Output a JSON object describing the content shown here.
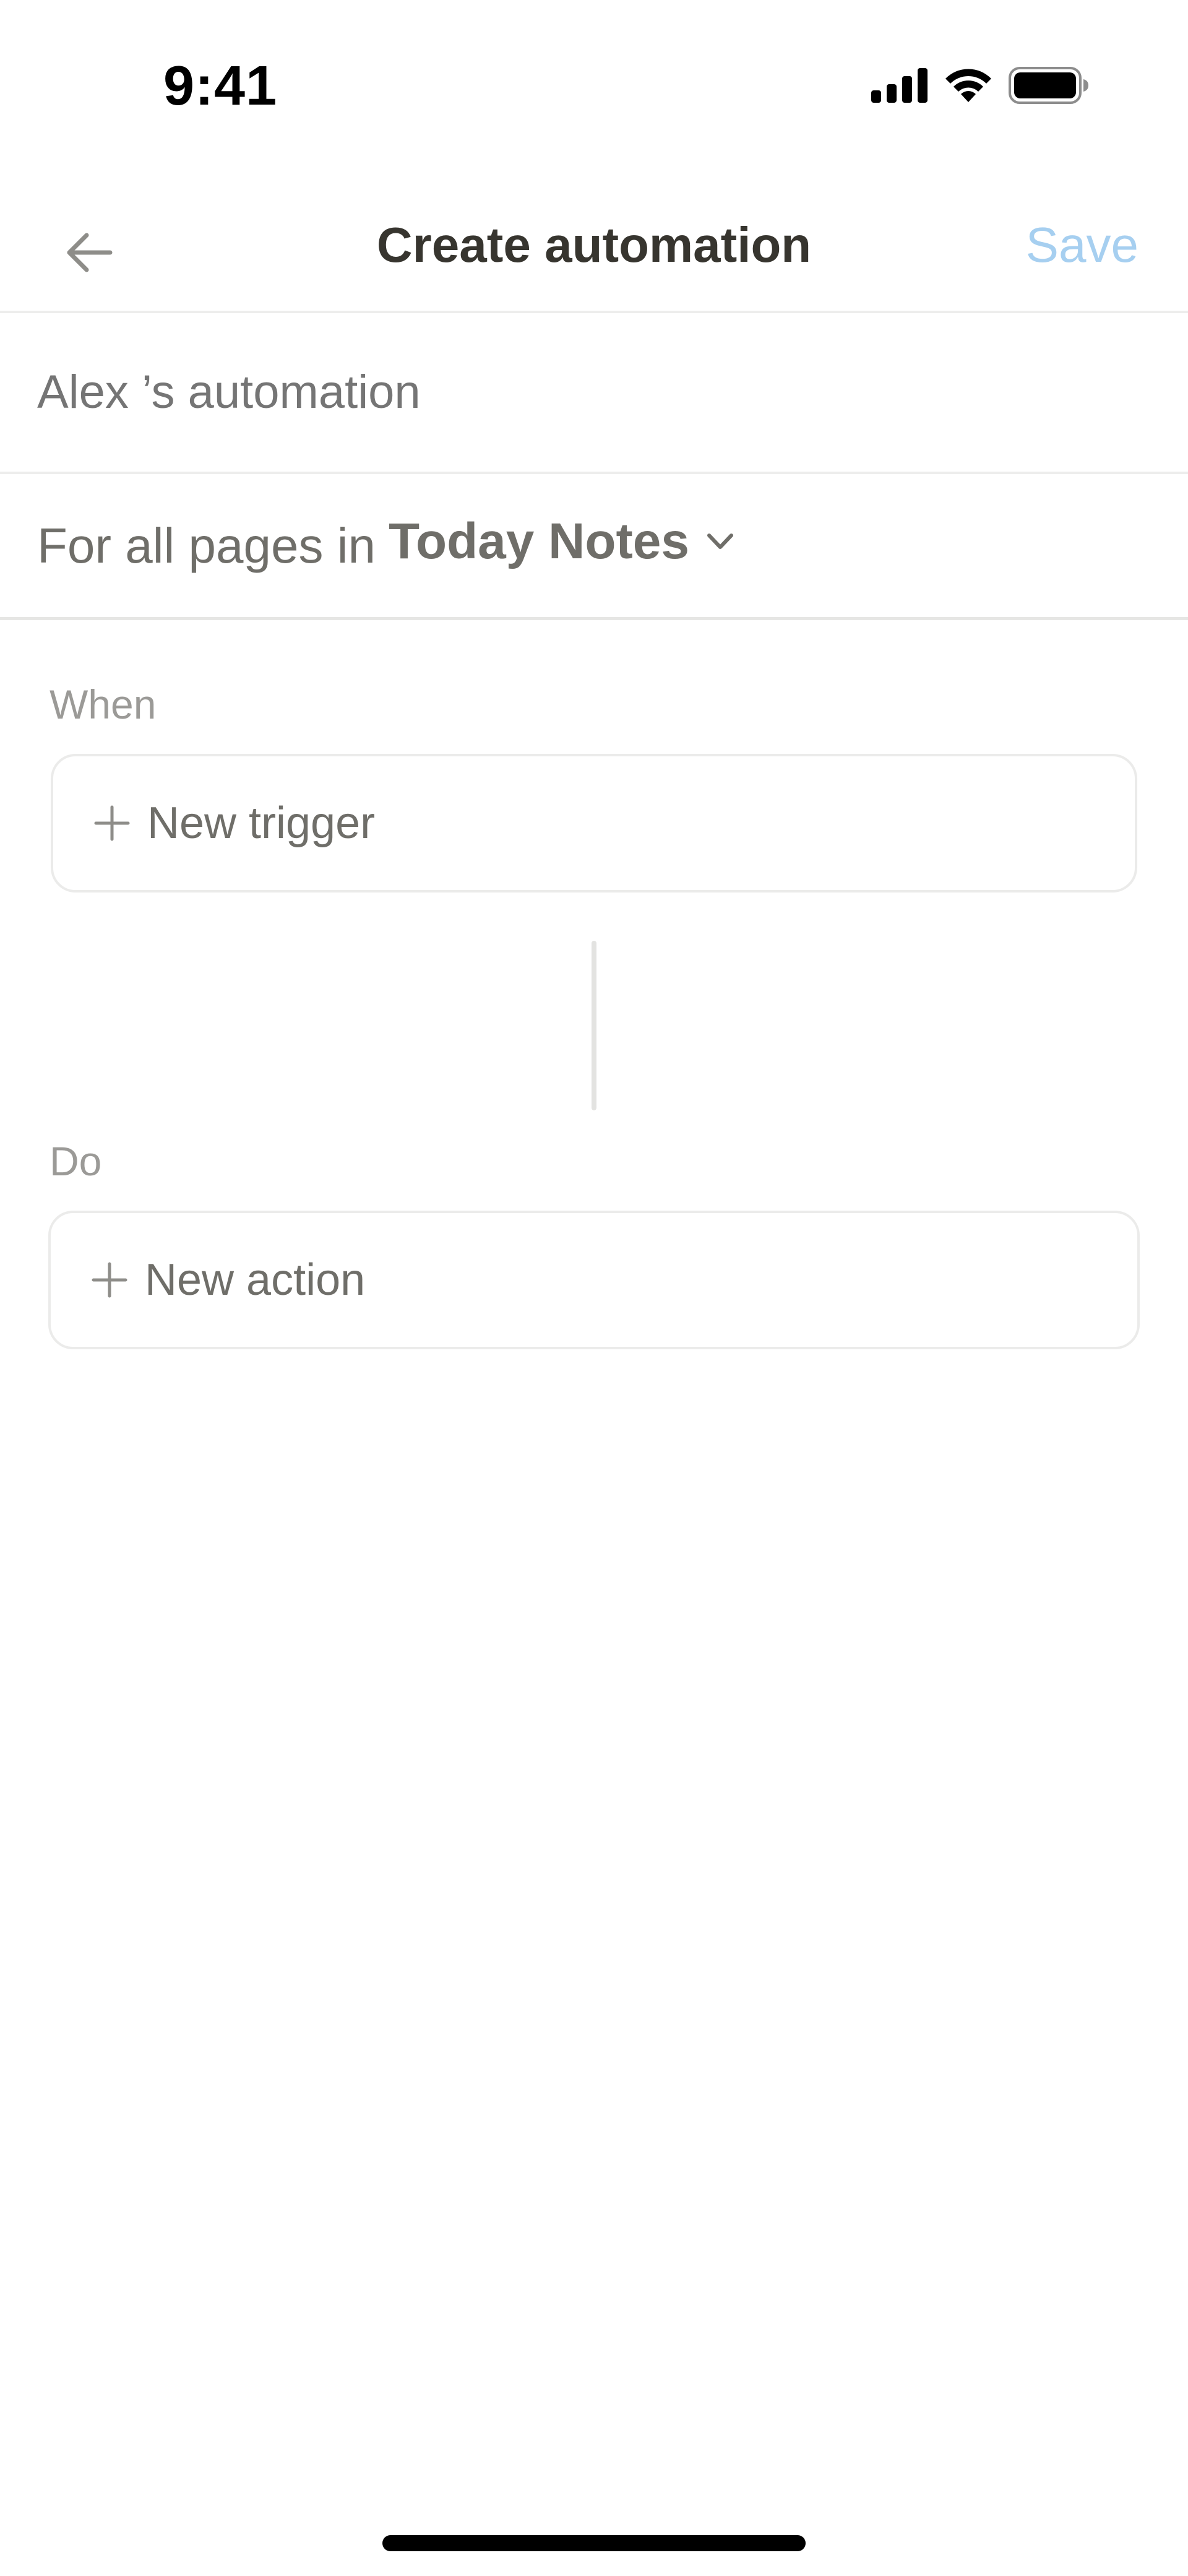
{
  "status_bar": {
    "time": "9:41",
    "icons": [
      "signal-icon",
      "wifi-icon",
      "battery-icon"
    ]
  },
  "header": {
    "title": "Create automation",
    "save_label": "Save",
    "back_icon": "arrow-left-icon"
  },
  "automation": {
    "name_placeholder": "Alex ’s automation",
    "name_value": ""
  },
  "scope": {
    "label": "For all pages in",
    "database": "Today Notes",
    "dropdown_icon": "chevron-down-icon"
  },
  "when": {
    "label": "When",
    "add_label": "New trigger"
  },
  "do": {
    "label": "Do",
    "add_label": "New action"
  },
  "colors": {
    "save_disabled": "#a6cff0",
    "text_primary": "#37352f",
    "text_muted": "#9b9a97",
    "border": "#ebebea"
  }
}
